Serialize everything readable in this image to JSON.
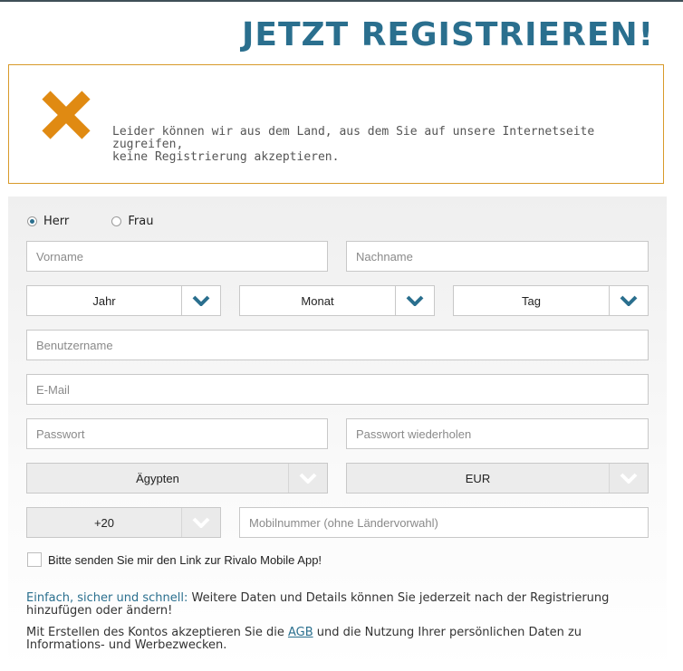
{
  "header": {
    "title": "JETZT REGISTRIEREN!"
  },
  "alert": {
    "icon": "close-x-icon",
    "message_line1": "Leider können wir aus dem Land, aus dem Sie auf unsere Internetseite zugreifen,",
    "message_line2": "keine Registrierung akzeptieren."
  },
  "gender": {
    "options": [
      {
        "label": "Herr",
        "selected": true
      },
      {
        "label": "Frau",
        "selected": false
      }
    ]
  },
  "fields": {
    "first_name": "Vorname",
    "last_name": "Nachname",
    "username": "Benutzername",
    "email": "E-Mail",
    "password": "Passwort",
    "password_repeat": "Passwort wiederholen",
    "mobile": "Mobilnummer (ohne Ländervorwahl)"
  },
  "birthdate": {
    "year": "Jahr",
    "month": "Monat",
    "day": "Tag"
  },
  "country": "Ägypten",
  "currency": "EUR",
  "phone_prefix": "+20",
  "app_checkbox_label": "Bitte senden Sie mir den Link zur Rivalo Mobile App!",
  "info": {
    "highlight": "Einfach, sicher und schnell:",
    "text": " Weitere Daten und Details können Sie jederzeit nach der Registrierung hinzufügen oder ändern!",
    "terms_before": "Mit Erstellen des Kontos akzeptieren Sie die ",
    "terms_link": "AGB",
    "terms_after": " und die Nutzung Ihrer persönlichen Daten zu Informations- und Werbezwecken."
  },
  "colors": {
    "accent": "#2a6f8e",
    "warning": "#e08a12",
    "alert_border": "#d89a2a"
  }
}
